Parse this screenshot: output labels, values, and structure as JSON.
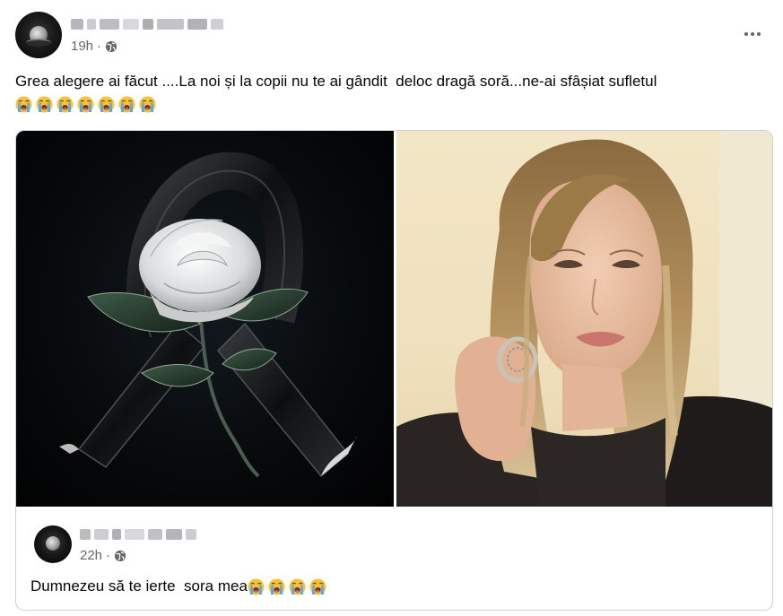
{
  "post": {
    "time": "19h",
    "separator": "·",
    "privacy_icon": "globe-icon",
    "caption": "Grea alegere ai făcut ....La noi și la copii nu te ai gândit  deloc dragă soră...ne-ai sfâșiat sufletul",
    "caption_emojis": [
      "😭",
      "😭",
      "😭",
      "😭",
      "😭",
      "😭",
      "😭"
    ],
    "more_icon": "more-horizontal-icon"
  },
  "shared": {
    "time": "22h",
    "separator": "·",
    "privacy_icon": "globe-icon",
    "text": "Dumnezeu să te ierte  sora mea",
    "text_emojis": [
      "😭",
      "😭",
      "😭",
      "😭"
    ],
    "images": [
      "black-ribbon-white-rose-image",
      "woman-portrait-image"
    ]
  },
  "colors": {
    "text": "#050505",
    "meta": "#65676b",
    "border": "#ced0d4"
  }
}
